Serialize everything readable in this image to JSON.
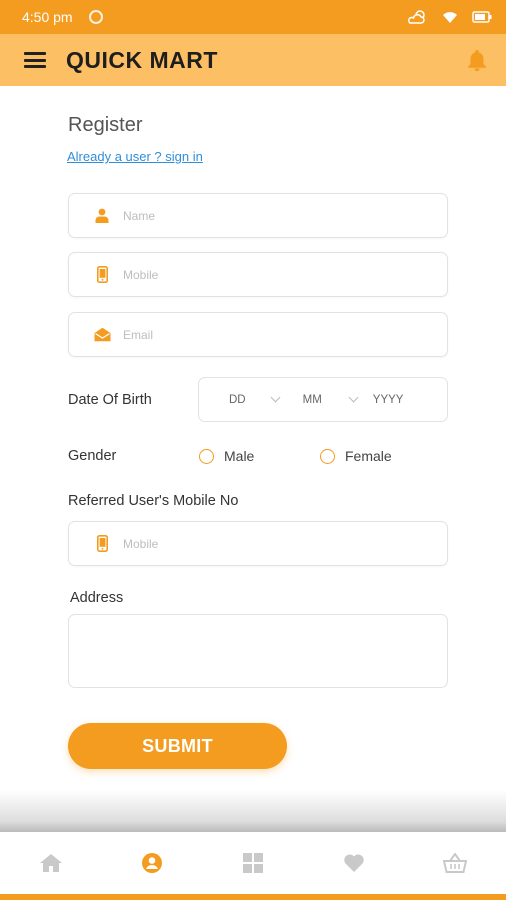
{
  "status_bar": {
    "time": "4:50 pm"
  },
  "app_bar": {
    "title": "QUICK MART"
  },
  "form": {
    "title": "Register",
    "signin_link": "Already a user ? sign in",
    "name_placeholder": "Name",
    "mobile_placeholder": "Mobile",
    "email_placeholder": "Email",
    "dob_label": "Date Of Birth",
    "dob_day": "DD",
    "dob_month": "MM",
    "dob_year": "YYYY",
    "gender_label": "Gender",
    "gender_options": [
      "Male",
      "Female"
    ],
    "referred_label": "Referred User's Mobile No",
    "referred_placeholder": "Mobile",
    "address_label": "Address",
    "submit_label": "SUBMIT"
  },
  "bottom_nav": {
    "items": [
      "home-icon",
      "account-icon",
      "grid-icon",
      "heart-icon",
      "basket-icon"
    ],
    "active_index": 1
  },
  "colors": {
    "accent": "#f39c1f",
    "app_bar": "#fdbf63",
    "link": "#2f8fd8",
    "inactive_icon": "#c9c9c9"
  }
}
